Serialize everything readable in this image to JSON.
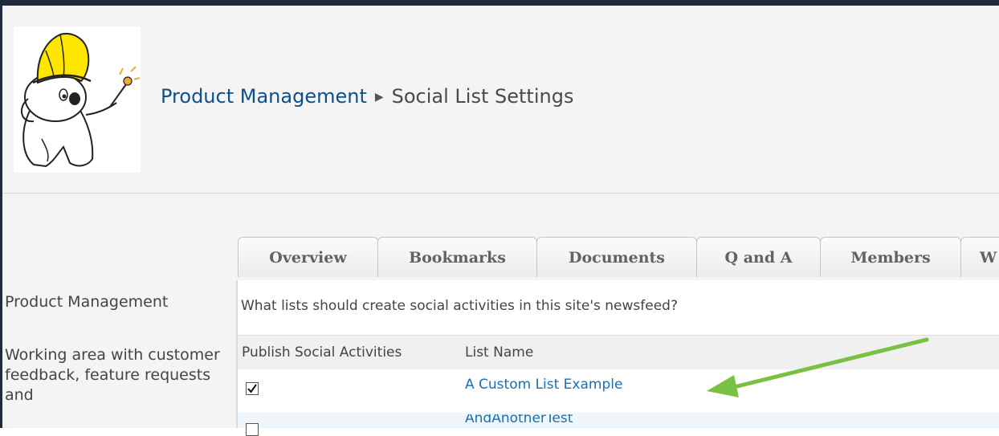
{
  "header": {
    "site_title": "Product Management",
    "page_title": "Social List Settings"
  },
  "tabs": [
    {
      "label": "Overview"
    },
    {
      "label": "Bookmarks"
    },
    {
      "label": "Documents"
    },
    {
      "label": "Q and A"
    },
    {
      "label": "Members"
    },
    {
      "label": "W"
    }
  ],
  "sidebar": {
    "title": "Product Management",
    "description": "Working area with customer feedback, feature requests and"
  },
  "main": {
    "question": "What lists should create social activities in this site's newsfeed?",
    "columns": {
      "publish": "Publish Social Activities",
      "list_name": "List Name"
    },
    "rows": [
      {
        "checked": true,
        "name": "A Custom List Example"
      },
      {
        "checked": false,
        "name": "AndAnotherTest"
      }
    ]
  },
  "colors": {
    "link": "#1a6fb4",
    "arrow": "#7ac043",
    "topbar": "#1f2a3a"
  }
}
